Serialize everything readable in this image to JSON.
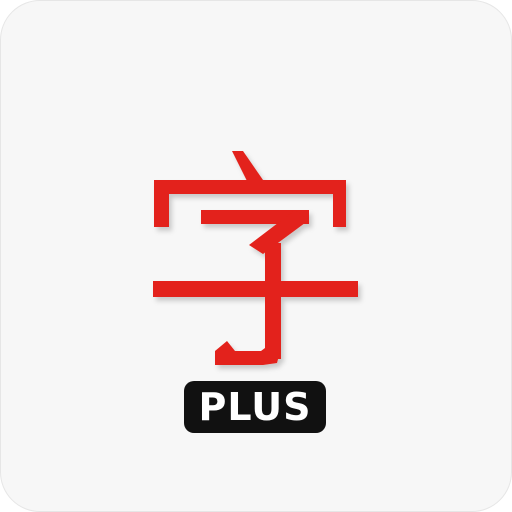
{
  "app_icon": {
    "glyph": "字",
    "glyph_color": "#e3221a",
    "background_color": "#f7f7f7",
    "badge": {
      "label": "PLUS",
      "background_color": "#111111",
      "text_color": "#ffffff"
    }
  }
}
